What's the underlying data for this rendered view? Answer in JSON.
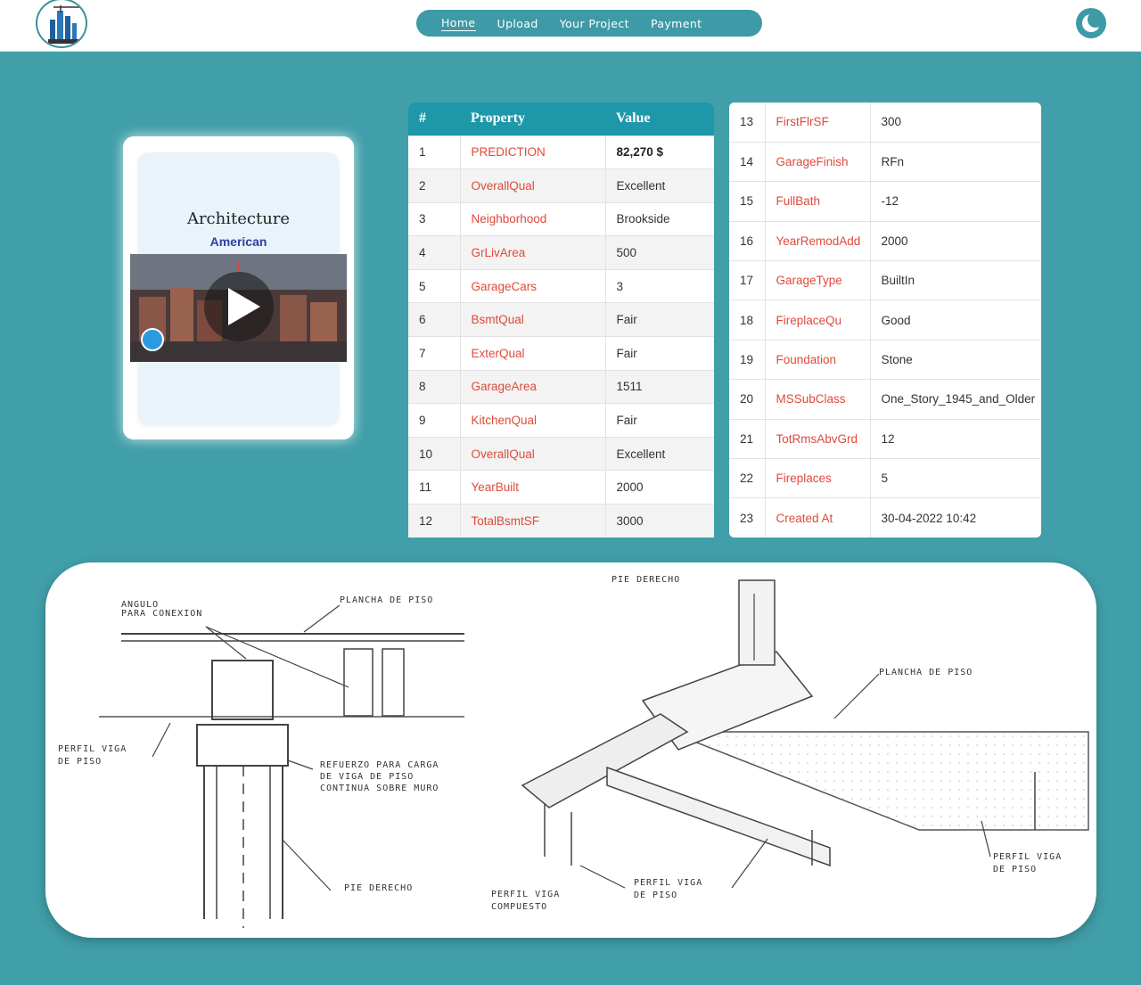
{
  "header": {
    "logo_icon": "building-crane-logo",
    "nav": [
      {
        "label": "Home",
        "active": true
      },
      {
        "label": "Upload",
        "active": false
      },
      {
        "label": "Your Project",
        "active": false
      },
      {
        "label": "Payment",
        "active": false
      }
    ],
    "theme_toggle_icon": "moon-icon"
  },
  "card": {
    "title": "Architecture",
    "subtitle": "American",
    "video_icon": "play-icon",
    "badge_icon": "cube-icon"
  },
  "table_left": {
    "headers": [
      "#",
      "Property",
      "Value"
    ],
    "rows": [
      {
        "n": "1",
        "prop": "PREDICTION",
        "val": "82,270 $"
      },
      {
        "n": "2",
        "prop": "OverallQual",
        "val": "Excellent"
      },
      {
        "n": "3",
        "prop": "Neighborhood",
        "val": "Brookside"
      },
      {
        "n": "4",
        "prop": "GrLivArea",
        "val": "500"
      },
      {
        "n": "5",
        "prop": "GarageCars",
        "val": "3"
      },
      {
        "n": "6",
        "prop": "BsmtQual",
        "val": "Fair"
      },
      {
        "n": "7",
        "prop": "ExterQual",
        "val": "Fair"
      },
      {
        "n": "8",
        "prop": "GarageArea",
        "val": "1511"
      },
      {
        "n": "9",
        "prop": "KitchenQual",
        "val": "Fair"
      },
      {
        "n": "10",
        "prop": "OverallQual",
        "val": "Excellent"
      },
      {
        "n": "11",
        "prop": "YearBuilt",
        "val": "2000"
      },
      {
        "n": "12",
        "prop": "TotalBsmtSF",
        "val": "3000"
      }
    ]
  },
  "table_right": {
    "rows": [
      {
        "n": "13",
        "prop": "FirstFlrSF",
        "val": "300"
      },
      {
        "n": "14",
        "prop": "GarageFinish",
        "val": "RFn"
      },
      {
        "n": "15",
        "prop": "FullBath",
        "val": "-12"
      },
      {
        "n": "16",
        "prop": "YearRemodAdd",
        "val": "2000"
      },
      {
        "n": "17",
        "prop": "GarageType",
        "val": "BuiltIn"
      },
      {
        "n": "18",
        "prop": "FireplaceQu",
        "val": "Good"
      },
      {
        "n": "19",
        "prop": "Foundation",
        "val": "Stone"
      },
      {
        "n": "20",
        "prop": "MSSubClass",
        "val": "One_Story_1945_and_Older"
      },
      {
        "n": "21",
        "prop": "TotRmsAbvGrd",
        "val": "12"
      },
      {
        "n": "22",
        "prop": "Fireplaces",
        "val": "5"
      },
      {
        "n": "23",
        "prop": "Created At",
        "val": "30-04-2022 10:42"
      }
    ]
  },
  "drawing": {
    "labels": [
      "ANGULO PARA CONEXION",
      "PLANCHA DE PISO",
      "PIE DERECHO",
      "PLANCHA DE PISO",
      "PERFIL VIGA DE PISO",
      "REFUERZO PARA CARGA DE VIGA DE PISO CONTINUA SOBRE MURO",
      "PIE DERECHO",
      "PERFIL VIGA COMPUESTO",
      "PERFIL VIGA DE PISO",
      "PERFIL VIGA DE PISO"
    ]
  },
  "colors": {
    "page_bg": "#419fa9",
    "nav_bg": "#3e9aa6",
    "table_header": "#1e98a8",
    "property_text": "#e0493b"
  }
}
